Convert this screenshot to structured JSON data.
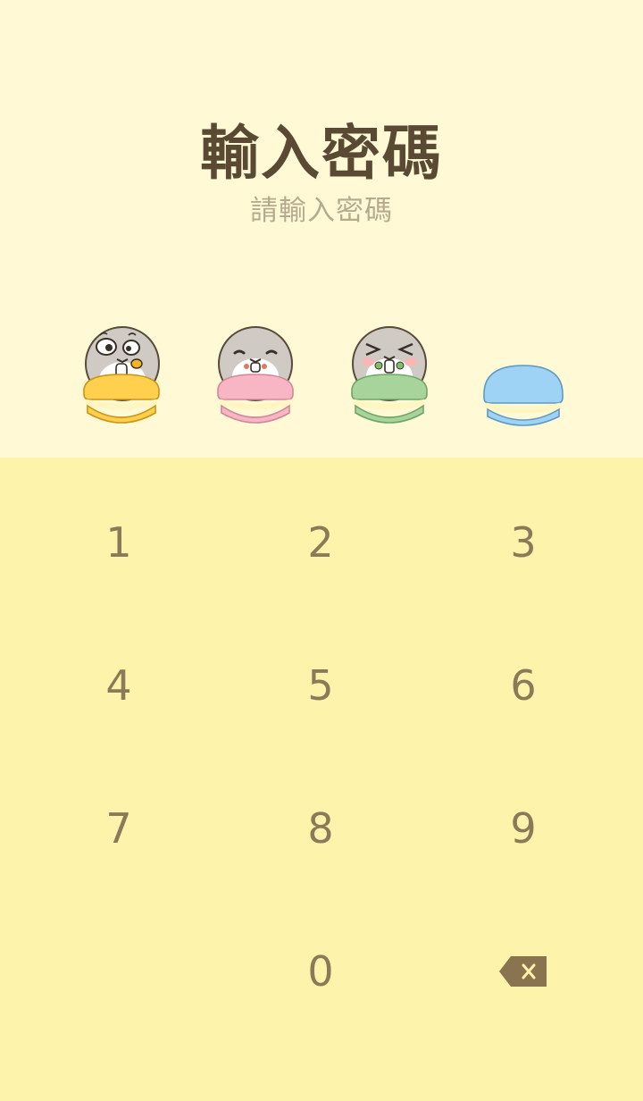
{
  "header": {
    "title": "輸入密碼",
    "subtitle": "請輸入密碼"
  },
  "indicators": [
    {
      "state": "filled",
      "expression": "surprised",
      "macaron_color": "#ffcf4d"
    },
    {
      "state": "filled",
      "expression": "calm",
      "macaron_color": "#f8b6c4"
    },
    {
      "state": "filled",
      "expression": "squint",
      "macaron_color": "#a6d49a"
    },
    {
      "state": "empty",
      "macaron_color": "#9fd3f5"
    }
  ],
  "keypad": {
    "keys": [
      "1",
      "2",
      "3",
      "4",
      "5",
      "6",
      "7",
      "8",
      "9",
      "0"
    ],
    "backspace_icon": "backspace-icon"
  },
  "colors": {
    "top_background": "#fff9d6",
    "keypad_background": "#fef3ab",
    "title": "#5a4a34",
    "subtitle": "#b5aa8e",
    "key_text": "#8a7a58",
    "backspace": "#8a7450"
  }
}
